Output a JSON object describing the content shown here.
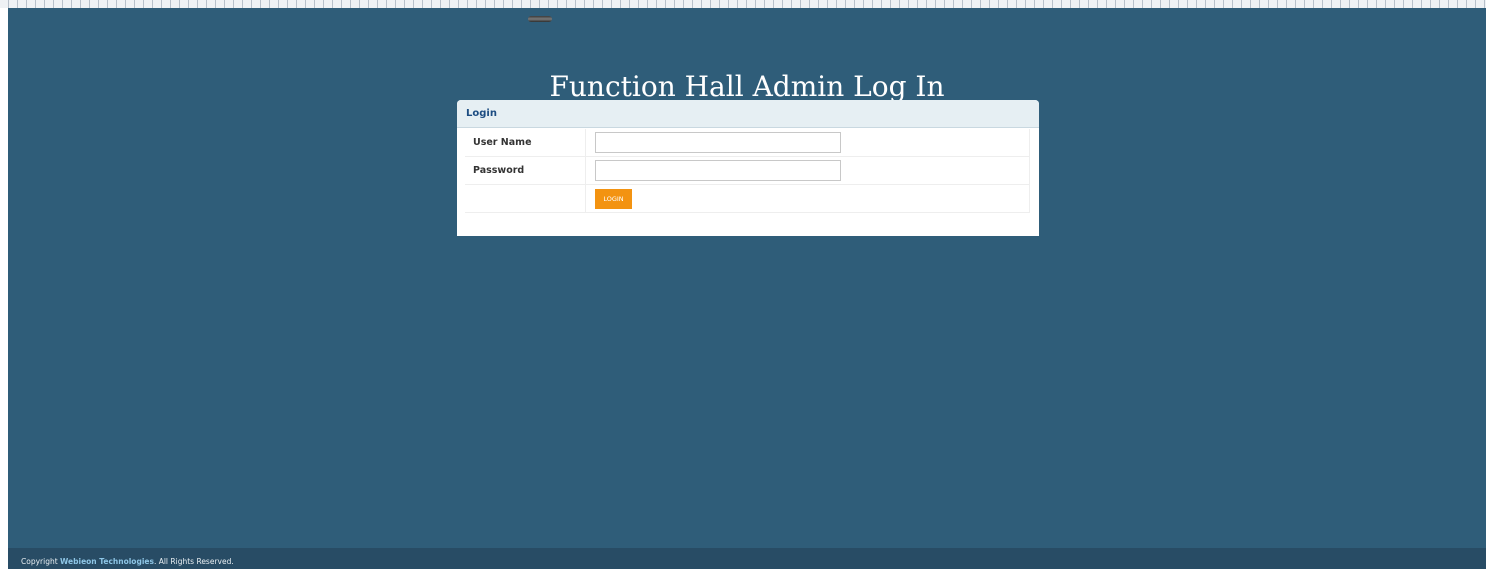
{
  "page": {
    "title": "Function Hall Admin Log In"
  },
  "login_panel": {
    "header": "Login",
    "username_label": "User Name",
    "username_value": "",
    "password_label": "Password",
    "password_value": "",
    "login_button": "LOGIN"
  },
  "footer": {
    "prefix": "Copyright ",
    "company": "Webieon Technologies",
    "suffix": ". All Rights Reserved."
  },
  "colors": {
    "background": "#2f5d79",
    "footer_background": "#284c65",
    "header_background": "#e6eff3",
    "header_text": "#1d4d82",
    "button": "#f39311",
    "footer_link": "#8ec6e6"
  }
}
